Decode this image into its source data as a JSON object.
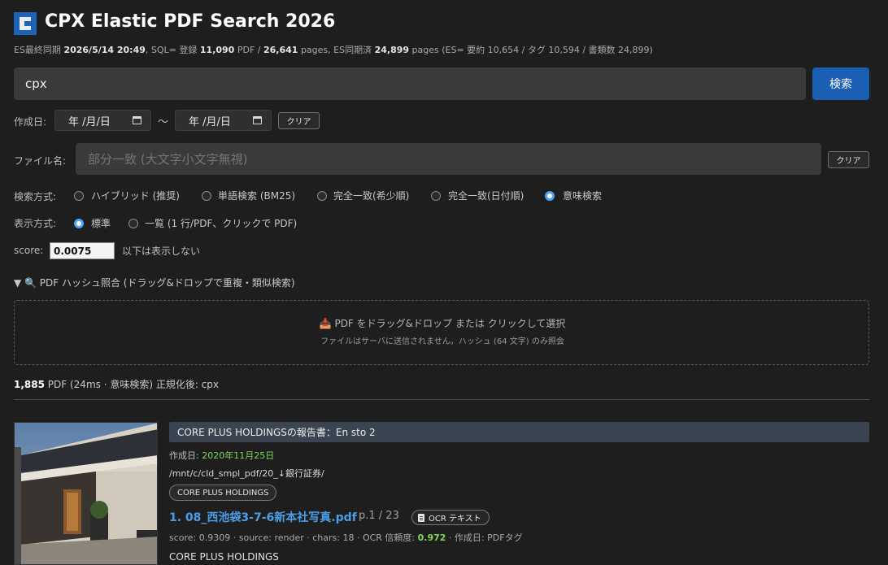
{
  "app": {
    "title": "CPX Elastic PDF Search 2026",
    "stats": {
      "es_sync_label": "ES最終同期",
      "es_sync_time": "2026/5/14 20:49",
      "sql_label": ", SQL= 登録",
      "pdf_count": "11,090",
      "pdf_unit": "PDF /",
      "page_count": "26,641",
      "pages_label": "pages, ES同期済",
      "es_pages": "24,899",
      "es_detail": "pages (ES= 要約 10,654 / タグ 10,594 / 書類数 24,899)"
    }
  },
  "search": {
    "query": "cpx",
    "button_label": "検索"
  },
  "filters": {
    "date_label": "作成日:",
    "date_from": "年 /月/日",
    "date_to": "年 /月/日",
    "date_sep": "〜",
    "date_clear": "クリア",
    "file_label": "ファイル名:",
    "file_placeholder": "部分一致 (大文字小文字無視)",
    "file_clear": "クリア",
    "method_label": "検索方式:",
    "methods": [
      {
        "label": "ハイブリッド (推奨)",
        "selected": false
      },
      {
        "label": "単語検索 (BM25)",
        "selected": false
      },
      {
        "label": "完全一致(希少順)",
        "selected": false
      },
      {
        "label": "完全一致(日付順)",
        "selected": false
      },
      {
        "label": "意味検索",
        "selected": true
      }
    ],
    "display_label": "表示方式:",
    "displays": [
      {
        "label": "標準",
        "selected": true
      },
      {
        "label": "一覧 (1 行/PDF、クリックで PDF)",
        "selected": false
      }
    ],
    "score_label": "score:",
    "score_value": "0.0075",
    "score_suffix": "以下は表示しない"
  },
  "hash": {
    "summary": "▼ 🔍 PDF ハッシュ照合 (ドラッグ&ドロップで重複・類似検索)",
    "drop_main": "📥 PDF をドラッグ&ドロップ または クリックして選択",
    "drop_sub": "ファイルはサーバに送信されません。ハッシュ (64 文字) のみ照会"
  },
  "results_summary": {
    "count": "1,885",
    "detail": "PDF (24ms · 意味検索) 正規化後: cpx"
  },
  "results": [
    {
      "title": "CORE PLUS HOLDINGSの報告書：En sto 2",
      "created_label": "作成日:",
      "created": "2020年11月25日",
      "path": "/mnt/c/cld_smpl_pdf/20_↓銀行証券/",
      "tag": "CORE PLUS HOLDINGS",
      "file": "1. 08_西池袋3-7-6新本社写真.pdf",
      "page": "p.1 / 23",
      "ocr_badge": "OCR テキスト",
      "score_prefix": "score: 0.9309 · source: render · chars: 18 · OCR 信頼度:",
      "ocr_conf": "0.972",
      "score_suffix": "· 作成日: PDFタグ",
      "company": "CORE PLUS HOLDINGS"
    }
  ]
}
